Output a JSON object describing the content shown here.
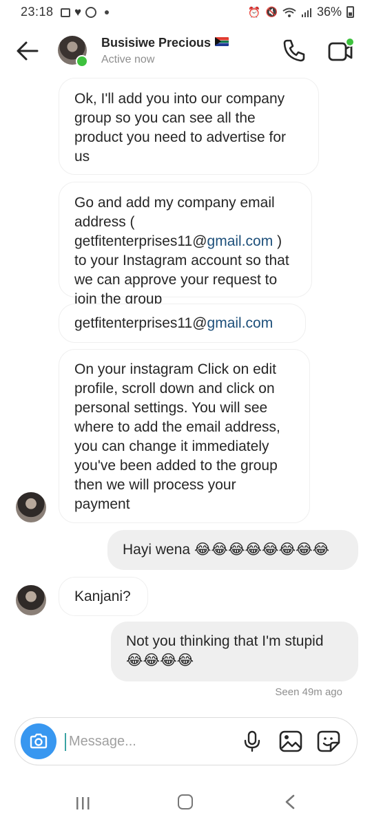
{
  "status_bar": {
    "time": "23:18",
    "battery": "36%"
  },
  "header": {
    "name": "Busisiwe Precious",
    "status": "Active now"
  },
  "messages": [
    {
      "from": "them",
      "text": "Ok, I'll add you into our company group so you can see all the product you need to advertise for us"
    },
    {
      "from": "them",
      "text_before": "Go and add my company email address ( getfitenterprises11@",
      "link": "gmail.com",
      "text_after": " ) to your Instagram account so that we can approve your request to join the group"
    },
    {
      "from": "them",
      "text_before": "getfitenterprises11@",
      "link": "gmail.com"
    },
    {
      "from": "them",
      "text": "On your instagram Click on edit profile, scroll down and click on personal settings. You will see where to add the email address, you can change it immediately you've been added to the group then we will process your payment"
    },
    {
      "from": "me",
      "text": "Hayi wena 😂😂😂😂😂😂😂😂"
    },
    {
      "from": "them",
      "text": "Kanjani?"
    },
    {
      "from": "me",
      "text": "Not you thinking that I'm stupid 😂😂😂😂"
    }
  ],
  "seen_label": "Seen 49m ago",
  "composer": {
    "placeholder": "Message..."
  },
  "colors": {
    "accent": "#3897f0",
    "online": "#3ec13e",
    "bubble_out": "#efefef",
    "link": "#1d4f7a"
  }
}
